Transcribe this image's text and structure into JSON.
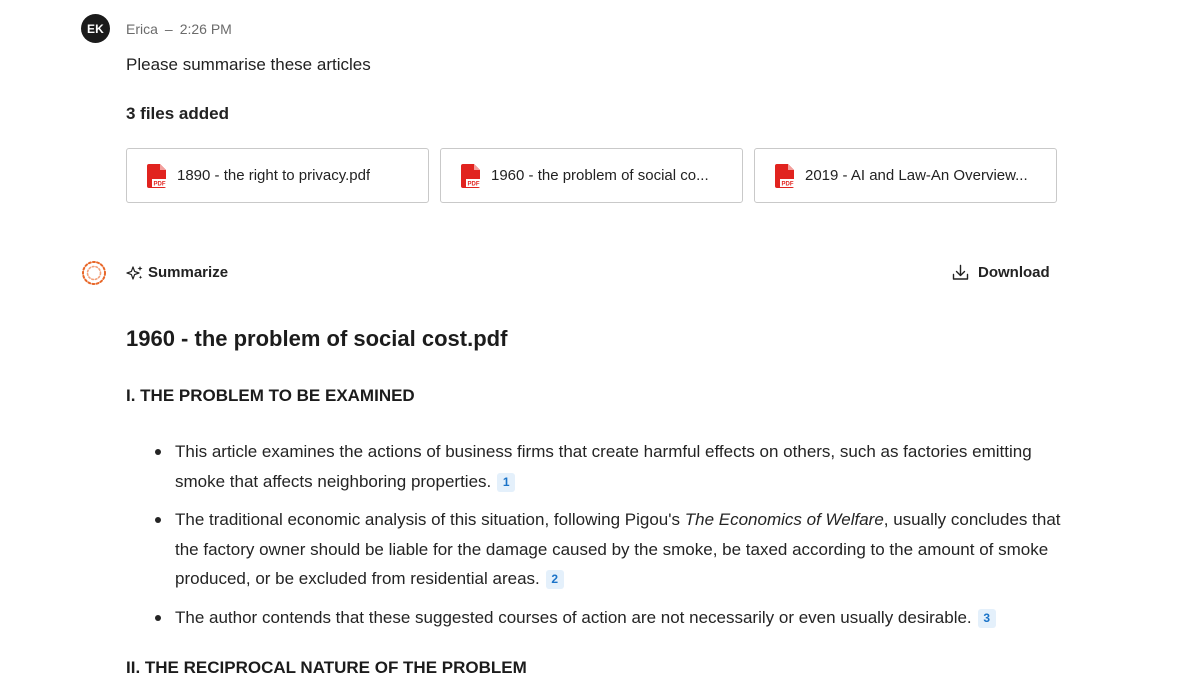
{
  "user_message": {
    "avatar_initials": "EK",
    "author": "Erica",
    "separator": "–",
    "time": "2:26 PM",
    "text": "Please summarise these articles",
    "files_title": "3 files added",
    "files": [
      {
        "name": "1890 - the right to privacy.pdf",
        "icon": "pdf-icon"
      },
      {
        "name": "1960 - the problem of social co...",
        "icon": "pdf-icon"
      },
      {
        "name": "2019 - AI and Law-An Overview...",
        "icon": "pdf-icon"
      }
    ]
  },
  "assistant": {
    "logo_icon": "assistant-logo-icon",
    "action_label": "Summarize",
    "download_label": "Download"
  },
  "summary": {
    "doc_title": "1960 - the problem of social cost.pdf",
    "section1_heading": "I. THE PROBLEM TO BE EXAMINED",
    "bullets": [
      {
        "text_before": "This article examines the actions of business firms that create harmful effects on others, such as factories emitting smoke that affects neighboring properties.",
        "citation": "1"
      },
      {
        "text_before": "The traditional economic analysis of this situation, following Pigou's ",
        "italic": "The Economics of Welfare",
        "text_after": ", usually concludes that the factory owner should be liable for the damage caused by the smoke, be taxed according to the amount of smoke produced, or be excluded from residential areas.",
        "citation": "2"
      },
      {
        "text_before": "The author contends that these suggested courses of action are not necessarily or even usually desirable.",
        "citation": "3"
      }
    ],
    "section2_heading": "II. THE RECIPROCAL NATURE OF THE PROBLEM"
  },
  "colors": {
    "avatar_bg": "#1b1b1b",
    "pdf_red": "#e1231f",
    "citation_text": "#1a73c8",
    "citation_bg": "#e4f0fb",
    "logo_orange": "#e8682a"
  }
}
